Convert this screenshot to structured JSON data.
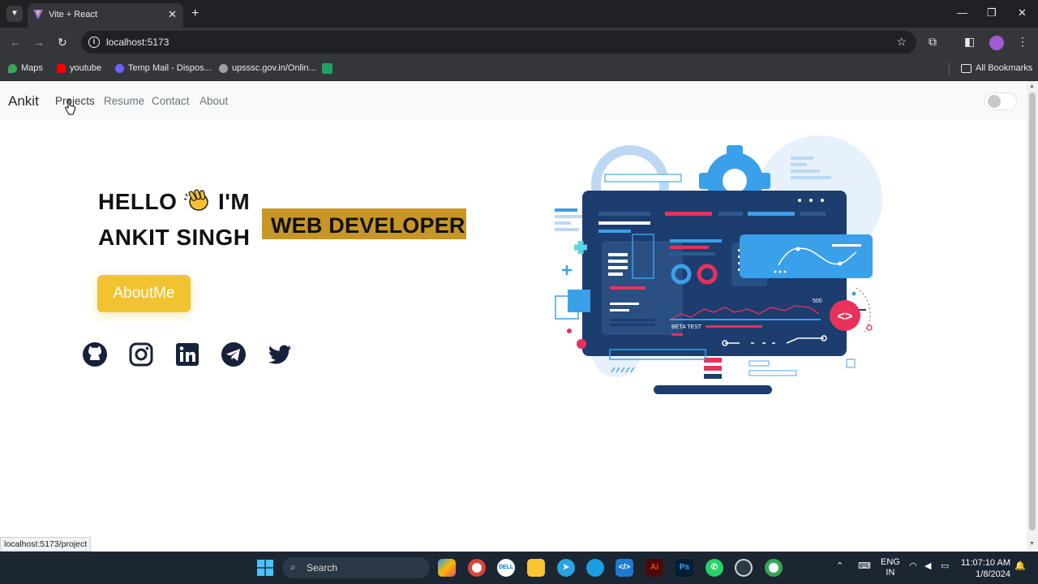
{
  "browser": {
    "tab_title": "Vite + React",
    "url": "localhost:5173",
    "bookmarks": [
      {
        "label": "Maps",
        "color": "#34a853"
      },
      {
        "label": "youtube",
        "color": "#ff0000"
      },
      {
        "label": "Temp Mail - Dispos...",
        "color": "#6c63ff"
      },
      {
        "label": "upsssc.gov.in/Onlin...",
        "color": "#9aa0a6"
      },
      {
        "label": "",
        "color": "#1fa463"
      }
    ],
    "all_bookmarks_label": "All Bookmarks",
    "status_url": "localhost:5173/project"
  },
  "navbar": {
    "brand": "Ankit",
    "links": [
      "Projects",
      "Resume",
      "Contact",
      "About"
    ]
  },
  "hero": {
    "line1_start": "HELLO",
    "line1_end": "I'M",
    "line2": "ANKIT SINGH",
    "role": "WEB DEVELOPER",
    "cta": "AboutMe"
  },
  "social_icons": [
    "github-icon",
    "instagram-icon",
    "linkedin-icon",
    "telegram-icon",
    "twitter-icon"
  ],
  "illustration": {
    "badge": "<>",
    "chart_value": "500",
    "beta_label": "BETA TEST"
  },
  "taskbar": {
    "search_label": "Search",
    "lang_line1": "ENG",
    "lang_line2": "IN",
    "time": "11:07:10 AM",
    "date": "1/8/2024"
  },
  "colors": {
    "accent_yellow": "#f2c330",
    "role_background": "#c89627",
    "monitor_navy": "#1c3d6e",
    "illustration_blue": "#3aa0ea",
    "illustration_red": "#e8315b"
  }
}
